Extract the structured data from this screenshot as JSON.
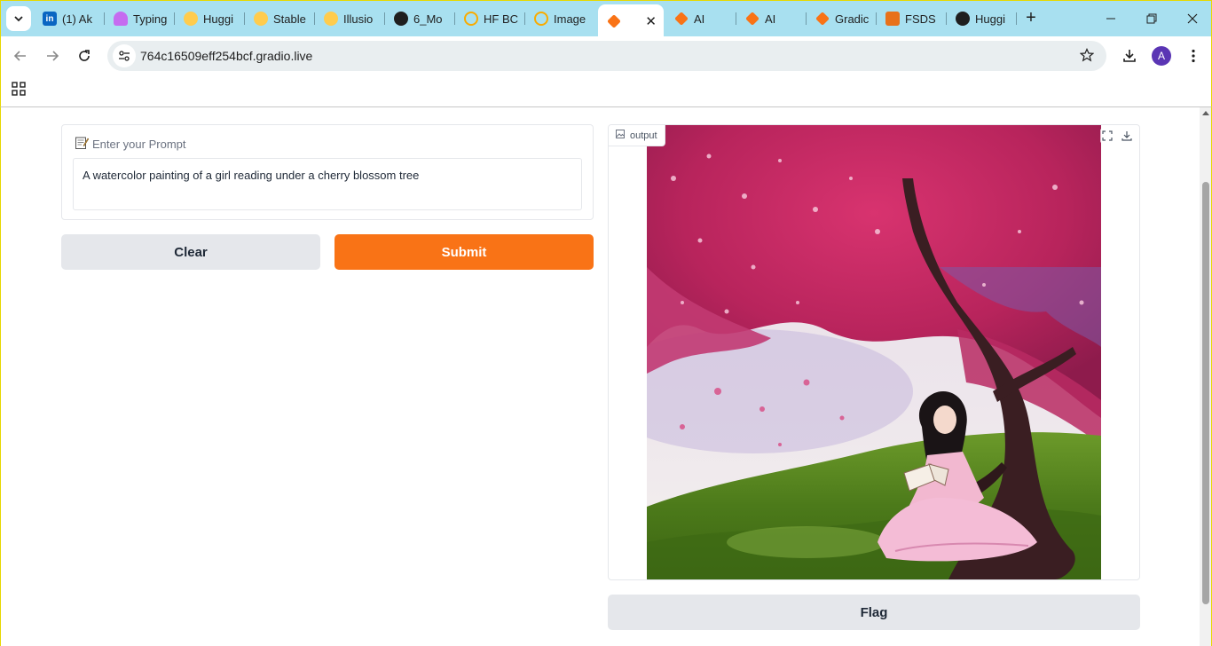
{
  "browser": {
    "tabs": [
      {
        "title": "(1) Ak",
        "favicon": "linkedin-icon",
        "color": "#0a66c2"
      },
      {
        "title": "Typing",
        "favicon": "ghost-icon",
        "color": "#c56cf0"
      },
      {
        "title": "Huggi",
        "favicon": "huggingface-icon",
        "color": "#ffcc4d"
      },
      {
        "title": "Stable",
        "favicon": "huggingface-icon",
        "color": "#ffcc4d"
      },
      {
        "title": "Illusio",
        "favicon": "huggingface-icon",
        "color": "#ffcc4d"
      },
      {
        "title": "6_Mo",
        "favicon": "github-icon",
        "color": "#1f1f1f"
      },
      {
        "title": "HF BC",
        "favicon": "colab-icon",
        "color": "#f9ab00"
      },
      {
        "title": "Image",
        "favicon": "colab-icon",
        "color": "#f9ab00"
      },
      {
        "title": "",
        "favicon": "gradio-icon",
        "color": "#f97316",
        "active": true
      },
      {
        "title": "AI",
        "favicon": "gradio-icon",
        "color": "#f97316"
      },
      {
        "title": "AI",
        "favicon": "gradio-icon",
        "color": "#f97316"
      },
      {
        "title": "Gradic",
        "favicon": "gradio-icon",
        "color": "#f97316"
      },
      {
        "title": "FSDS",
        "favicon": "fsds-icon",
        "color": "#e8711a"
      },
      {
        "title": "Huggi",
        "favicon": "github-icon",
        "color": "#1f1f1f"
      }
    ],
    "url": "764c16509eff254bcf.gradio.live",
    "avatar_letter": "A"
  },
  "app": {
    "prompt_label": "Enter your Prompt",
    "prompt_value": "A watercolor painting of a girl reading under a cherry blossom tree",
    "clear_label": "Clear",
    "submit_label": "Submit",
    "output_label": "output",
    "flag_label": "Flag"
  },
  "colors": {
    "accent": "#f97316",
    "secondary_button": "#e5e7eb",
    "tabstrip": "#a8e0f0"
  }
}
